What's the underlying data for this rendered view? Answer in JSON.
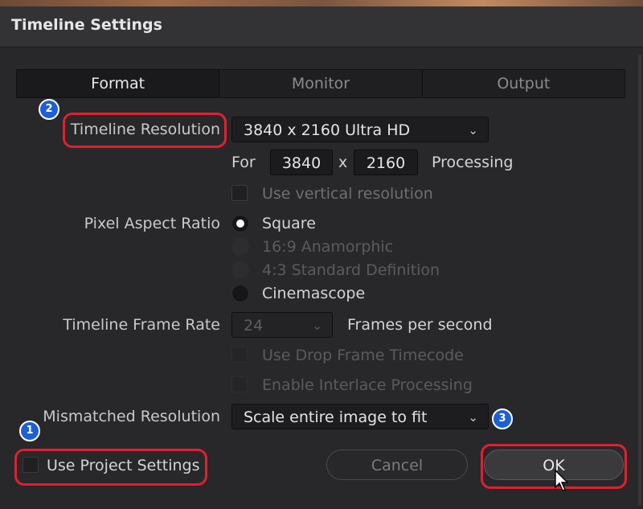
{
  "dialog": {
    "title": "Timeline Settings"
  },
  "tabs": [
    {
      "label": "Format",
      "active": true
    },
    {
      "label": "Monitor",
      "active": false
    },
    {
      "label": "Output",
      "active": false
    }
  ],
  "timeline_resolution": {
    "label": "Timeline Resolution",
    "value": "3840 x 2160 Ultra HD",
    "for_label": "For",
    "width": "3840",
    "times": "x",
    "height": "2160",
    "processing_label": "Processing",
    "vertical_label": "Use vertical resolution"
  },
  "pixel_aspect_ratio": {
    "label": "Pixel Aspect Ratio",
    "options": [
      {
        "label": "Square",
        "selected": true,
        "enabled": true
      },
      {
        "label": "16:9 Anamorphic",
        "selected": false,
        "enabled": false
      },
      {
        "label": "4:3 Standard Definition",
        "selected": false,
        "enabled": false
      },
      {
        "label": "Cinemascope",
        "selected": false,
        "enabled": true
      }
    ]
  },
  "frame_rate": {
    "label": "Timeline Frame Rate",
    "value": "24",
    "unit_label": "Frames per second",
    "drop_frame_label": "Use Drop Frame Timecode",
    "interlace_label": "Enable Interlace Processing"
  },
  "mismatched": {
    "label": "Mismatched Resolution",
    "value": "Scale entire image to fit"
  },
  "footer": {
    "use_project_settings": "Use Project Settings",
    "cancel": "Cancel",
    "ok": "OK"
  },
  "annotations": {
    "badge1": "1",
    "badge2": "2",
    "badge3": "3"
  },
  "colors": {
    "highlight": "#e0202e",
    "badge": "#1d5fd6"
  }
}
